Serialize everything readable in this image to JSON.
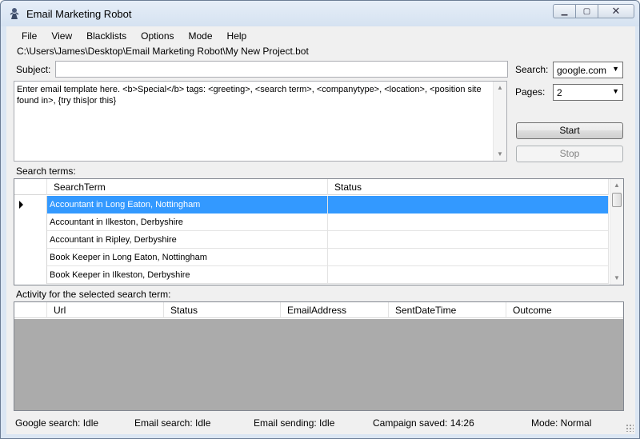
{
  "window": {
    "title": "Email Marketing Robot"
  },
  "menu": [
    "File",
    "View",
    "Blacklists",
    "Options",
    "Mode",
    "Help"
  ],
  "project_path": "C:\\Users\\James\\Desktop\\Email Marketing Robot\\My New Project.bot",
  "subject": {
    "label": "Subject:",
    "value": ""
  },
  "template": {
    "text": "Enter email template here. <b>Special</b> tags: <greeting>, <search term>, <companytype>, <location>, <position site found in>, {try this|or this}"
  },
  "search": {
    "label": "Search:",
    "value": "google.com"
  },
  "pages": {
    "label": "Pages:",
    "value": "2"
  },
  "buttons": {
    "start": "Start",
    "stop": "Stop"
  },
  "search_terms": {
    "label": "Search terms:",
    "columns": [
      "SearchTerm",
      "Status"
    ],
    "rows": [
      {
        "term": "Accountant in Long Eaton, Nottingham",
        "status": ""
      },
      {
        "term": "Accountant in Ilkeston, Derbyshire",
        "status": ""
      },
      {
        "term": "Accountant in Ripley, Derbyshire",
        "status": ""
      },
      {
        "term": "Book Keeper in Long Eaton, Nottingham",
        "status": ""
      },
      {
        "term": "Book Keeper in Ilkeston, Derbyshire",
        "status": ""
      }
    ]
  },
  "activity": {
    "label": "Activity for the selected search term:",
    "columns": [
      "Url",
      "Status",
      "EmailAddress",
      "SentDateTime",
      "Outcome"
    ]
  },
  "status_bar": {
    "google": "Google search: Idle",
    "email_search": "Email search: Idle",
    "email_sending": "Email sending: Idle",
    "campaign": "Campaign saved: 14:26",
    "mode": "Mode: Normal"
  }
}
